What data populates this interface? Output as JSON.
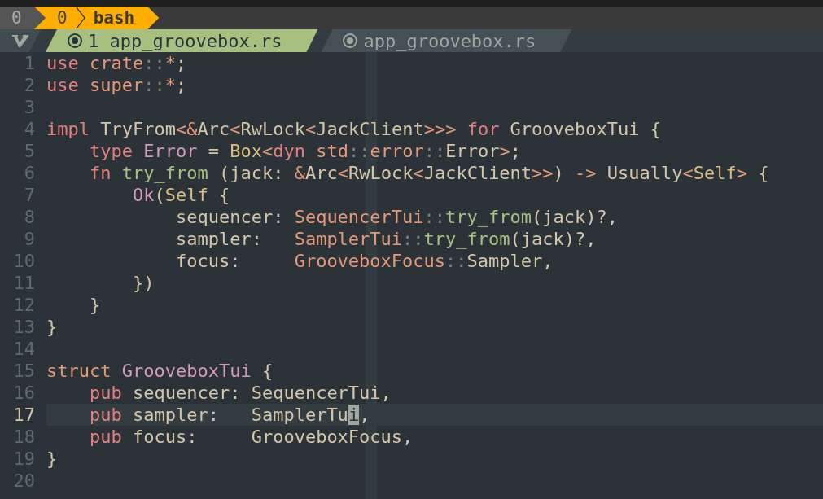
{
  "tmux": {
    "session": "0",
    "windows": [
      {
        "index": "0",
        "name": "bash",
        "selected": true
      }
    ]
  },
  "tabs": [
    {
      "number": "1",
      "label": "app_groovebox.rs",
      "selected": true
    },
    {
      "label": "app_groovebox.rs",
      "selected": false
    }
  ],
  "lines": [
    {
      "number": "1",
      "current": false,
      "tokens": [
        {
          "kind": "keyword",
          "text": "use"
        },
        {
          "kind": "punct",
          "text": " crate"
        },
        {
          "kind": "sep",
          "text": "::"
        },
        {
          "kind": "punct",
          "text": "*"
        },
        {
          "kind": "plain",
          "text": ";"
        }
      ]
    },
    {
      "number": "2",
      "current": false,
      "tokens": [
        {
          "kind": "keyword",
          "text": "use"
        },
        {
          "kind": "punct",
          "text": " super"
        },
        {
          "kind": "sep",
          "text": "::"
        },
        {
          "kind": "punct",
          "text": "*"
        },
        {
          "kind": "plain",
          "text": ";"
        }
      ]
    },
    {
      "number": "3",
      "current": false
    },
    {
      "number": "4",
      "current": false,
      "tokens": [
        {
          "kind": "keyword",
          "text": "impl"
        },
        {
          "kind": "plain",
          "text": " TryFrom"
        },
        {
          "kind": "punct",
          "text": "<&"
        },
        {
          "kind": "plain",
          "text": "Arc"
        },
        {
          "kind": "punct",
          "text": "<"
        },
        {
          "kind": "plain",
          "text": "RwLock"
        },
        {
          "kind": "punct",
          "text": "<"
        },
        {
          "kind": "plain",
          "text": "JackClient"
        },
        {
          "kind": "punct",
          "text": ">>>"
        },
        {
          "kind": "keyword",
          "text": " for"
        },
        {
          "kind": "plain",
          "text": " GrooveboxTui {"
        }
      ]
    },
    {
      "number": "5",
      "current": false,
      "tokens": [
        {
          "kind": "keyword",
          "text": "    type"
        },
        {
          "kind": "type",
          "text": " Error"
        },
        {
          "kind": "plain",
          "text": " = "
        },
        {
          "kind": "builtin",
          "text": "Box"
        },
        {
          "kind": "punct",
          "text": "<"
        },
        {
          "kind": "keyword",
          "text": "dyn"
        },
        {
          "kind": "punct",
          "text": " std"
        },
        {
          "kind": "sep",
          "text": "::"
        },
        {
          "kind": "punct",
          "text": "error"
        },
        {
          "kind": "sep",
          "text": "::"
        },
        {
          "kind": "plain",
          "text": "Error"
        },
        {
          "kind": "punct",
          "text": ">"
        },
        {
          "kind": "plain",
          "text": ";"
        }
      ]
    },
    {
      "number": "6",
      "current": false,
      "tokens": [
        {
          "kind": "keyword",
          "text": "    fn"
        },
        {
          "kind": "fn",
          "text": " try_from"
        },
        {
          "kind": "plain",
          "text": " (jack: "
        },
        {
          "kind": "punct",
          "text": "&"
        },
        {
          "kind": "plain",
          "text": "Arc"
        },
        {
          "kind": "punct",
          "text": "<"
        },
        {
          "kind": "plain",
          "text": "RwLock"
        },
        {
          "kind": "punct",
          "text": "<"
        },
        {
          "kind": "plain",
          "text": "JackClient"
        },
        {
          "kind": "punct",
          "text": ">>"
        },
        {
          "kind": "plain",
          "text": ") "
        },
        {
          "kind": "punct",
          "text": "->"
        },
        {
          "kind": "plain",
          "text": " Usually"
        },
        {
          "kind": "punct",
          "text": "<"
        },
        {
          "kind": "builtin",
          "text": "Self"
        },
        {
          "kind": "punct",
          "text": ">"
        },
        {
          "kind": "plain",
          "text": " {"
        }
      ]
    },
    {
      "number": "7",
      "current": false,
      "tokens": [
        {
          "kind": "type",
          "text": "        Ok"
        },
        {
          "kind": "plain",
          "text": "("
        },
        {
          "kind": "builtin",
          "text": "Self"
        },
        {
          "kind": "plain",
          "text": " {"
        }
      ]
    },
    {
      "number": "8",
      "current": false,
      "tokens": [
        {
          "kind": "plain",
          "text": "            sequencer: "
        },
        {
          "kind": "punct",
          "text": "SequencerTui"
        },
        {
          "kind": "sep",
          "text": "::"
        },
        {
          "kind": "fn",
          "text": "try_from"
        },
        {
          "kind": "plain",
          "text": "(jack)?,"
        }
      ]
    },
    {
      "number": "9",
      "current": false,
      "tokens": [
        {
          "kind": "plain",
          "text": "            sampler:   "
        },
        {
          "kind": "punct",
          "text": "SamplerTui"
        },
        {
          "kind": "sep",
          "text": "::"
        },
        {
          "kind": "fn",
          "text": "try_from"
        },
        {
          "kind": "plain",
          "text": "(jack)?,"
        }
      ]
    },
    {
      "number": "10",
      "current": false,
      "tokens": [
        {
          "kind": "plain",
          "text": "            focus:     "
        },
        {
          "kind": "punct",
          "text": "GrooveboxFocus"
        },
        {
          "kind": "sep",
          "text": "::"
        },
        {
          "kind": "plain",
          "text": "Sampler,"
        }
      ]
    },
    {
      "number": "11",
      "current": false,
      "tokens": [
        {
          "kind": "plain",
          "text": "        })"
        }
      ]
    },
    {
      "number": "12",
      "current": false,
      "tokens": [
        {
          "kind": "plain",
          "text": "    }"
        }
      ]
    },
    {
      "number": "13",
      "current": false,
      "tokens": [
        {
          "kind": "plain",
          "text": "}"
        }
      ]
    },
    {
      "number": "14",
      "current": false
    },
    {
      "number": "15",
      "current": false,
      "tokens": [
        {
          "kind": "punct",
          "text": "struct"
        },
        {
          "kind": "type",
          "text": " GrooveboxTui"
        },
        {
          "kind": "plain",
          "text": " {"
        }
      ]
    },
    {
      "number": "16",
      "current": false,
      "tokens": [
        {
          "kind": "keyword",
          "text": "    pub"
        },
        {
          "kind": "plain",
          "text": " sequencer: SequencerTui,"
        }
      ]
    },
    {
      "number": "17",
      "current": true,
      "tokens": [
        {
          "kind": "keyword",
          "text": "    pub"
        },
        {
          "kind": "plain",
          "text": " sampler:   SamplerTu"
        },
        {
          "kind": "cursor",
          "text": "i"
        },
        {
          "kind": "plain",
          "text": ","
        }
      ]
    },
    {
      "number": "18",
      "current": false,
      "tokens": [
        {
          "kind": "keyword",
          "text": "    pub"
        },
        {
          "kind": "plain",
          "text": " focus:     GrooveboxFocus,"
        }
      ]
    },
    {
      "number": "19",
      "current": false,
      "tokens": [
        {
          "kind": "plain",
          "text": "}"
        }
      ]
    },
    {
      "number": "20",
      "current": false
    }
  ]
}
